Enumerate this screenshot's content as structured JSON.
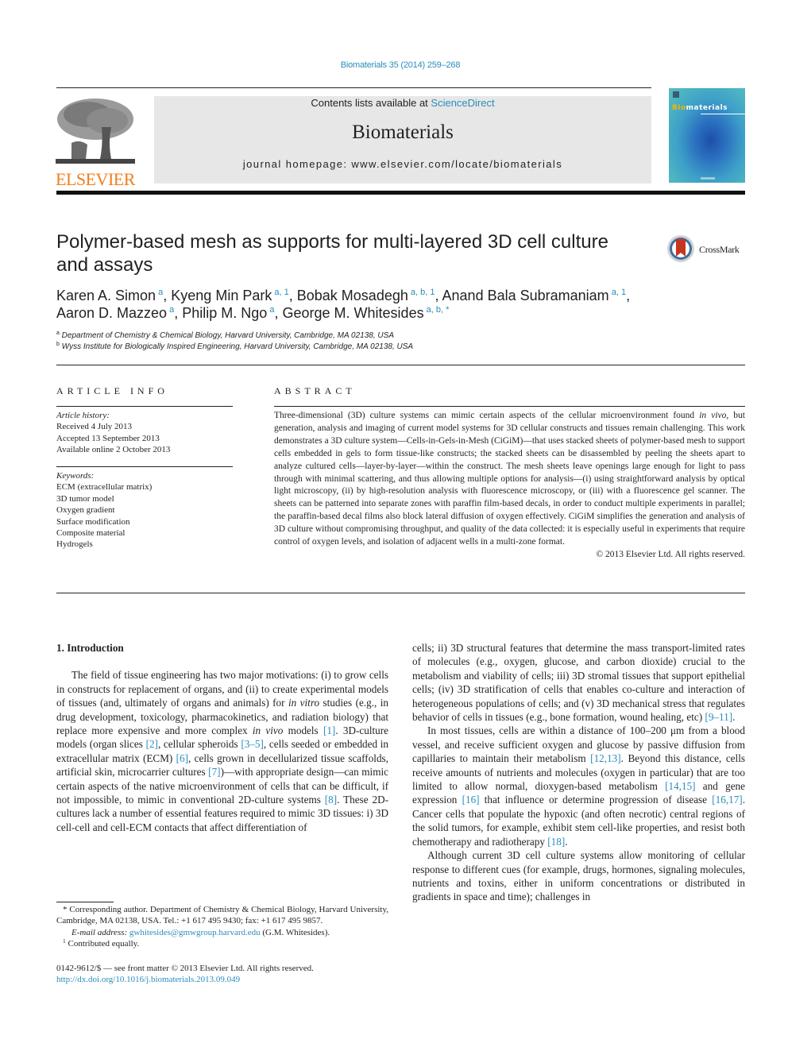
{
  "header": {
    "journal_ref": "Biomaterials 35 (2014) 259–268",
    "contents_prefix": "Contents lists available at ",
    "contents_link": "ScienceDirect",
    "journal_title": "Biomaterials",
    "homepage_label": "journal homepage: www.elsevier.com/locate/biomaterials",
    "publisher_logo_text": "ELSEVIER",
    "cover_title_bio": "Bio",
    "cover_title_rest": "materials",
    "colors": {
      "link": "#2a8cbd",
      "elsevier_orange": "#f07e1c",
      "banner_bg": "#e7e7e7"
    }
  },
  "article": {
    "title": "Polymer-based mesh as supports for multi-layered 3D cell culture and assays",
    "crossmark_label": "CrossMark",
    "authors": [
      {
        "name": "Karen A. Simon",
        "sup": "a",
        "sep": ", "
      },
      {
        "name": "Kyeng Min Park",
        "sup": "a, 1",
        "sep": ", "
      },
      {
        "name": "Bobak Mosadegh",
        "sup": "a, b, 1",
        "sep": ", "
      },
      {
        "name": "Anand Bala Subramaniam",
        "sup": "a, 1",
        "sep": ", "
      },
      {
        "name": "Aaron D. Mazzeo",
        "sup": "a",
        "sep": ", "
      },
      {
        "name": "Philip M. Ngo",
        "sup": "a",
        "sep": ", "
      },
      {
        "name": "George M. Whitesides",
        "sup": "a, b, *",
        "sep": ""
      }
    ],
    "affiliations": [
      {
        "key": "a",
        "text": "Department of Chemistry & Chemical Biology, Harvard University, Cambridge, MA 02138, USA"
      },
      {
        "key": "b",
        "text": "Wyss Institute for Biologically Inspired Engineering, Harvard University, Cambridge, MA 02138, USA"
      }
    ]
  },
  "article_info": {
    "heading": "ARTICLE INFO",
    "history_label": "Article history:",
    "received": "Received 4 July 2013",
    "accepted": "Accepted 13 September 2013",
    "online": "Available online 2 October 2013",
    "keywords_label": "Keywords:",
    "keywords": [
      "ECM (extracellular matrix)",
      "3D tumor model",
      "Oxygen gradient",
      "Surface modification",
      "Composite material",
      "Hydrogels"
    ]
  },
  "abstract": {
    "heading": "ABSTRACT",
    "part1": "Three-dimensional (3D) culture systems can mimic certain aspects of the cellular microenvironment found ",
    "italic1": "in vivo",
    "part2": ", but generation, analysis and imaging of current model systems for 3D cellular constructs and tissues remain challenging. This work demonstrates a 3D culture system—Cells-in-Gels-in-Mesh (CiGiM)—that uses stacked sheets of polymer-based mesh to support cells embedded in gels to form tissue-like constructs; the stacked sheets can be disassembled by peeling the sheets apart to analyze cultured cells—layer-by-layer—within the construct. The mesh sheets leave openings large enough for light to pass through with minimal scattering, and thus allowing multiple options for analysis—(i) using straightforward analysis by optical light microscopy, (ii) by high-resolution analysis with fluorescence microscopy, or (iii) with a fluorescence gel scanner. The sheets can be patterned into separate zones with paraffin film-based decals, in order to conduct multiple experiments in parallel; the paraffin-based decal films also block lateral diffusion of oxygen effectively. CiGiM simplifies the generation and analysis of 3D culture without compromising throughput, and quality of the data collected: it is especially useful in experiments that require control of oxygen levels, and isolation of adjacent wells in a multi-zone format.",
    "copyright": "© 2013 Elsevier Ltd. All rights reserved."
  },
  "body": {
    "section_heading": "1.  Introduction",
    "p1": [
      {
        "t": "The field of tissue engineering has two major motivations: (i) to grow cells in constructs for replacement of organs, and (ii) to create experimental models of tissues (and, ultimately of organs and animals) for "
      },
      {
        "i": "in vitro"
      },
      {
        "t": " studies (e.g., in drug development, toxicology, pharmacokinetics, and radiation biology) that replace more expensive and more complex "
      },
      {
        "i": "in vivo"
      },
      {
        "t": " models "
      },
      {
        "r": "[1]"
      },
      {
        "t": ". 3D-culture models (organ slices "
      },
      {
        "r": "[2]"
      },
      {
        "t": ", cellular spheroids "
      },
      {
        "r": "[3–5]"
      },
      {
        "t": ", cells seeded or embedded in extracellular matrix (ECM) "
      },
      {
        "r": "[6]"
      },
      {
        "t": ", cells grown in decellularized tissue scaffolds, artificial skin, microcarrier cultures "
      },
      {
        "r": "[7]"
      },
      {
        "t": ")—with appropriate design—can mimic certain aspects of the native microenvironment of cells that can be difficult, if not impossible, to mimic in conventional 2D-culture systems "
      },
      {
        "r": "[8]"
      },
      {
        "t": ". These 2D-cultures lack a number of essential features required to mimic 3D tissues: i) 3D cell-cell and cell-ECM contacts that affect differentiation of cells; ii) 3D structural features that determine the mass transport-limited rates of molecules (e.g., oxygen, glucose, and carbon dioxide) crucial to the metabolism and viability of cells; iii) 3D stromal tissues that support epithelial cells; (iv) 3D stratification of cells that enables co-culture and interaction of heterogeneous populations of cells; and (v) 3D mechanical stress that regulates behavior of cells in tissues (e.g., bone formation, wound healing, etc) "
      },
      {
        "r": "[9–11]"
      },
      {
        "t": "."
      }
    ],
    "p1_left_part": [
      {
        "t": "The field of tissue engineering has two major motivations: (i) to grow cells in constructs for replacement of organs, and (ii) to create experimental models of tissues (and, ultimately of organs and an­imals) for "
      },
      {
        "i": "in vitro"
      },
      {
        "t": " studies (e.g., in drug development, toxicology, pharmacokinetics, and radiation biology) that replace more expensive and more complex "
      },
      {
        "i": "in vivo"
      },
      {
        "t": " models "
      },
      {
        "r": "[1]"
      },
      {
        "t": ". 3D-culture models (organ slices "
      },
      {
        "r": "[2]"
      },
      {
        "t": ", cellular spheroids "
      },
      {
        "r": "[3–5]"
      },
      {
        "t": ", cells seeded or embedded in extracellular matrix (ECM) "
      },
      {
        "r": "[6]"
      },
      {
        "t": ", cells grown in decel­lularized tissue scaffolds, artificial skin, microcarrier cultures "
      },
      {
        "r": "[7]"
      },
      {
        "t": ")—with appropriate design—can mimic certain aspects of the native microenvironment of cells that can be difficult, if not impossible, to mimic in conventional 2D-culture systems "
      },
      {
        "r": "[8]"
      },
      {
        "t": ". These 2D-cultures lack a number of essential features required to mimic 3D tissues: i) 3D cell-cell and cell-ECM contacts that affect differentiation of"
      }
    ],
    "p1_right_part": [
      {
        "t": "cells; ii) 3D structural features that determine the mass transport-limited rates of molecules (e.g., oxygen, glucose, and carbon diox­ide) crucial to the metabolism and viability of cells; iii) 3D stromal tissues that support epithelial cells; (iv) 3D stratification of cells that enables co-culture and interaction of heterogeneous pop­ulations of cells; and (v) 3D mechanical stress that regulates behavior of cells in tissues (e.g., bone formation, wound healing, etc) "
      },
      {
        "r": "[9–11]"
      },
      {
        "t": "."
      }
    ],
    "p2": [
      {
        "t": "In most tissues, cells are within a distance of 100–200 μm from a blood vessel, and receive sufficient oxygen and glucose by passive diffusion from capillaries to maintain their metabolism "
      },
      {
        "r": "[12,13]"
      },
      {
        "t": ". Beyond this distance, cells receive amounts of nutrients and mol­ecules (oxygen in particular) that are too limited to allow normal, dioxygen-based metabolism "
      },
      {
        "r": "[14,15]"
      },
      {
        "t": " and gene expression "
      },
      {
        "r": "[16]"
      },
      {
        "t": " that influence or determine progression of disease "
      },
      {
        "r": "[16,17]"
      },
      {
        "t": ". Cancer cells that populate the hypoxic (and often necrotic) central regions of the solid tumors, for example, exhibit stem cell-like properties, and resist both chemotherapy and radiotherapy "
      },
      {
        "r": "[18]"
      },
      {
        "t": "."
      }
    ],
    "p3": [
      {
        "t": "Although current 3D cell culture systems allow monitoring of cellular response to different cues (for example, drugs, hormones, signaling molecules, nutrients and toxins, either in uniform concen­trations or distributed in gradients in space and time); challenges in"
      }
    ]
  },
  "footnotes": {
    "corresponding": "* Corresponding author. Department of Chemistry & Chemical Biology, Harvard University, Cambridge, MA 02138, USA. Tel.: +1 617 495 9430; fax: +1 617 495 9857.",
    "email_label": "E-mail address: ",
    "email": "gwhitesides@gmwgroup.harvard.edu",
    "email_suffix": " (G.M. Whitesides).",
    "contrib_mark": "1",
    "contrib_text": " Contributed equally."
  },
  "issn": {
    "line": "0142-9612/$ — see front matter © 2013 Elsevier Ltd. All rights reserved.",
    "doi": "http://dx.doi.org/10.1016/j.biomaterials.2013.09.049"
  }
}
